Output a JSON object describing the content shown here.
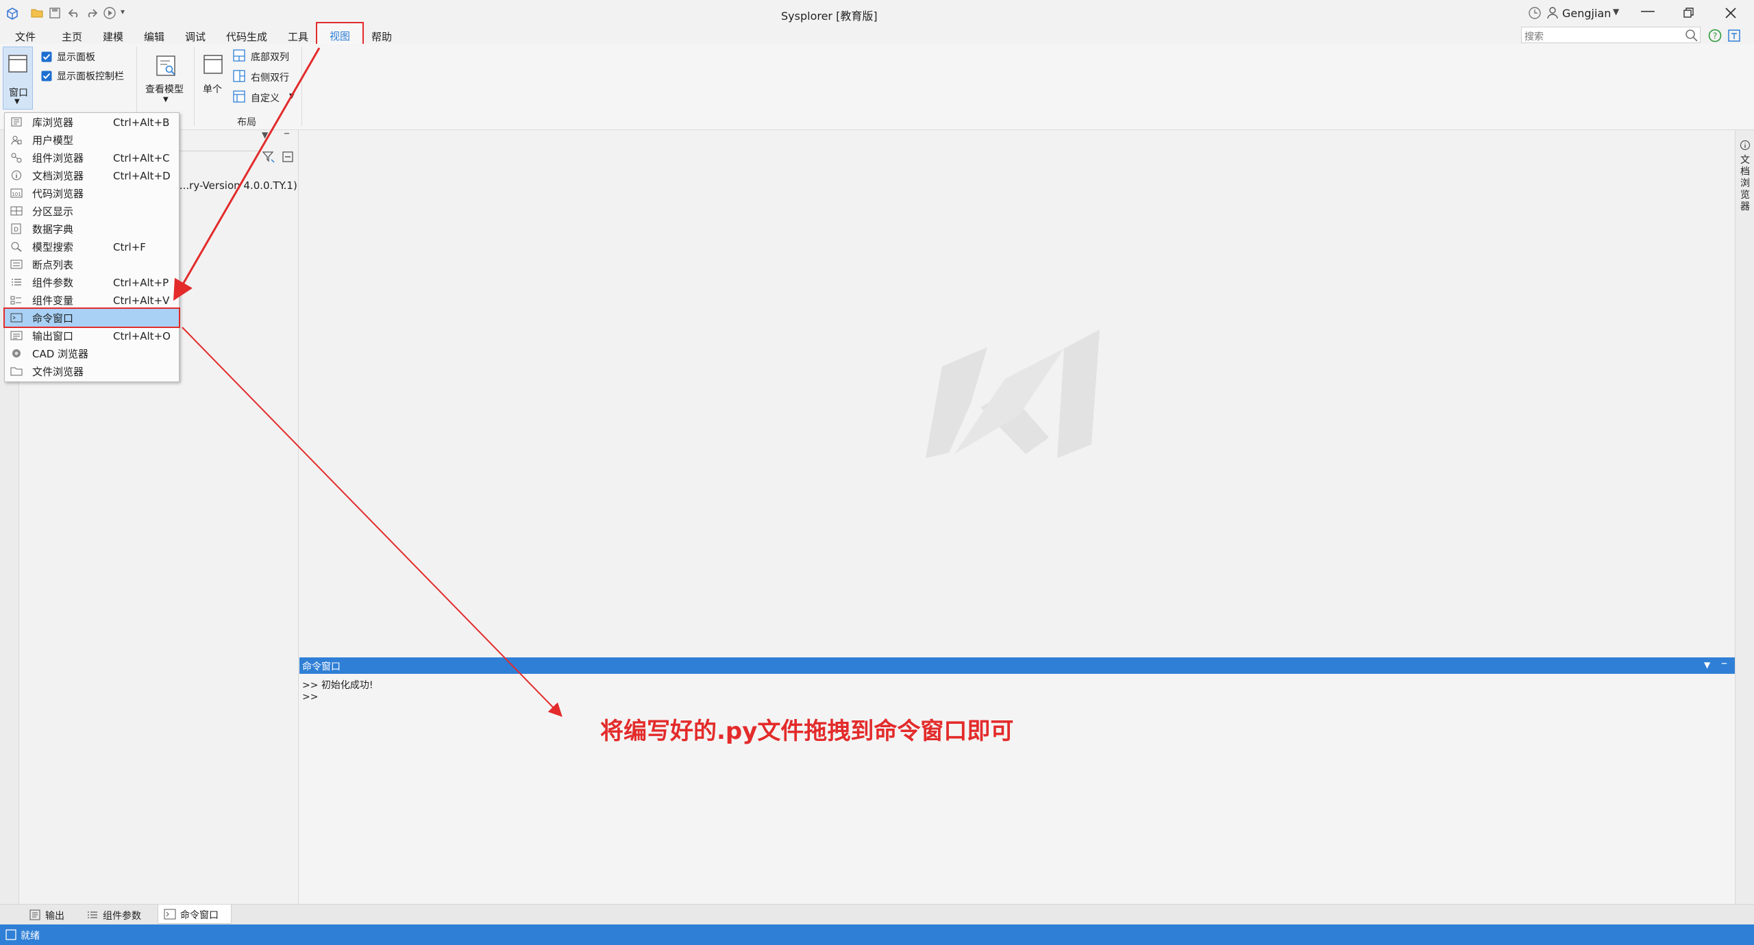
{
  "window": {
    "title": "Sysplorer [教育版]",
    "user": "Gengjian"
  },
  "menu": [
    "文件",
    "主页",
    "建模",
    "编辑",
    "调试",
    "代码生成",
    "工具",
    "视图",
    "帮助"
  ],
  "search": {
    "placeholder": "搜索"
  },
  "ribbon": {
    "window_btn": "窗口",
    "show_panel": "显示面板",
    "show_panel_control": "显示面板控制栏",
    "view_model": "查看模型",
    "single": "单个",
    "bottom_two_cols": "底部双列",
    "right_two_rows": "右侧双行",
    "custom": "自定义",
    "layout_group": "布局"
  },
  "dropdown": [
    {
      "label": "库浏览器",
      "shortcut": "Ctrl+Alt+B"
    },
    {
      "label": "用户模型",
      "shortcut": ""
    },
    {
      "label": "组件浏览器",
      "shortcut": "Ctrl+Alt+C"
    },
    {
      "label": "文档浏览器",
      "shortcut": "Ctrl+Alt+D"
    },
    {
      "label": "代码浏览器",
      "shortcut": ""
    },
    {
      "label": "分区显示",
      "shortcut": ""
    },
    {
      "label": "数据字典",
      "shortcut": ""
    },
    {
      "label": "模型搜索",
      "shortcut": "Ctrl+F"
    },
    {
      "label": "断点列表",
      "shortcut": ""
    },
    {
      "label": "组件参数",
      "shortcut": "Ctrl+Alt+P"
    },
    {
      "label": "组件变量",
      "shortcut": "Ctrl+Alt+V"
    },
    {
      "label": "命令窗口",
      "shortcut": ""
    },
    {
      "label": "输出窗口",
      "shortcut": "Ctrl+Alt+O"
    },
    {
      "label": "CAD 浏览器",
      "shortcut": ""
    },
    {
      "label": "文件浏览器",
      "shortcut": ""
    }
  ],
  "leftpanel": {
    "tree_text": "t...ry-Version 4.0.0.TY.1)"
  },
  "right_panel_label": "文档浏览器",
  "command_window": {
    "title": "命令窗口",
    "line1": ">> 初始化成功!",
    "line2": ">>"
  },
  "annotation": "将编写好的.py文件拖拽到命令窗口即可",
  "bottom_tabs": [
    "输出",
    "组件参数",
    "命令窗口"
  ],
  "status": "就绪",
  "colors": {
    "accent": "#2f7fd6",
    "annotation": "#e32b2b"
  }
}
